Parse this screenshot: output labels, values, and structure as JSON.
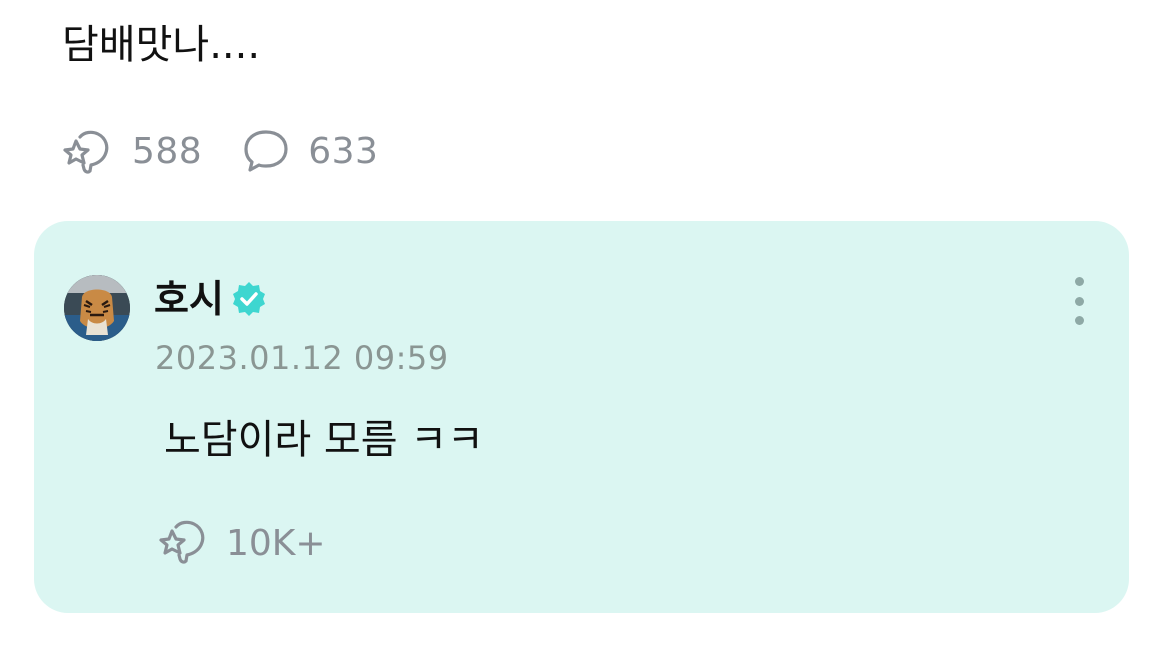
{
  "post": {
    "text": "담배맛나...."
  },
  "stats": {
    "likes": "588",
    "comments": "633"
  },
  "reply": {
    "author": "호시",
    "timestamp": "2023.01.12 09:59",
    "text": "노담이라 모름 ㅋㅋ",
    "likes": "10K+"
  },
  "icons": {
    "like": "like-icon",
    "comment": "comment-icon",
    "verified": "verified-badge-icon",
    "more": "more-vertical-icon"
  },
  "colors": {
    "card_background": "#dbf6f2",
    "verified_badge": "#3ed6d0",
    "muted_text": "#8a8f96"
  }
}
